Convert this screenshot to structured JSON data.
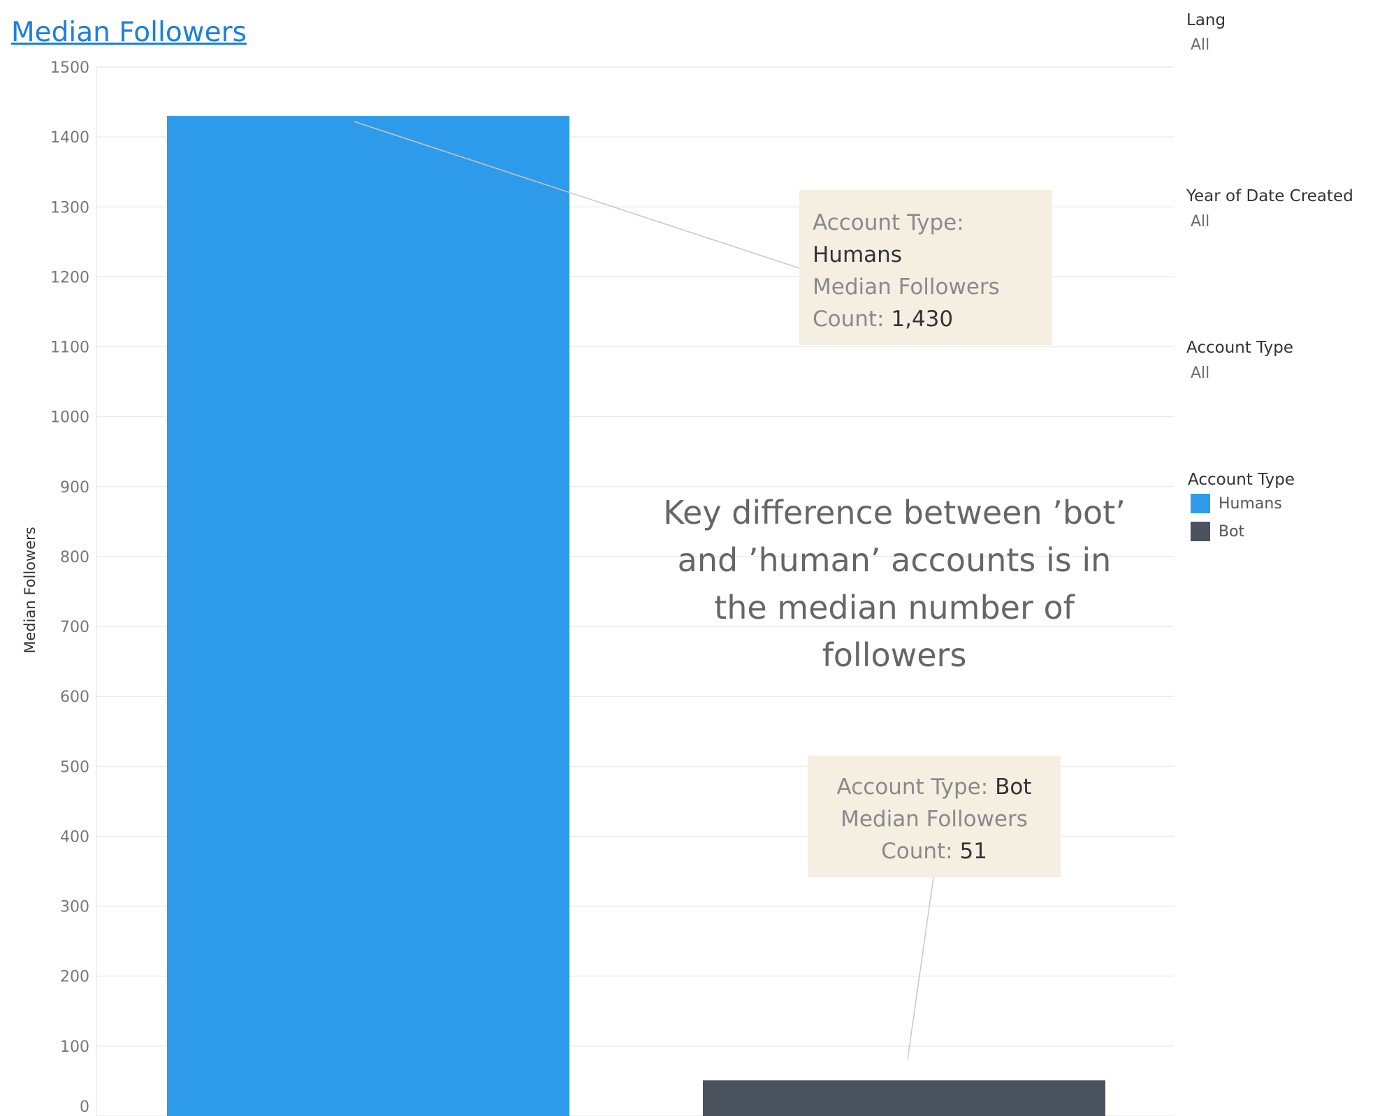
{
  "title": "Median Followers",
  "filters": [
    {
      "label": "Lang",
      "value": "All"
    },
    {
      "label": "Year of Date Created",
      "value": "All"
    },
    {
      "label": "Account Type",
      "value": "All"
    }
  ],
  "legend": {
    "title": "Account Type",
    "items": [
      {
        "label": "Humans",
        "color": "#2e9bea"
      },
      {
        "label": "Bot",
        "color": "#4a525d"
      }
    ]
  },
  "annotation": "Key difference between ’bot’ and ’human’ accounts is in the median number of followers",
  "callouts": {
    "humans": {
      "type_label": "Account Type:",
      "type_value": "Humans",
      "measure_label": "Median Followers",
      "count_label": "Count:",
      "count_value": "1,430"
    },
    "bot": {
      "type_label": "Account Type:",
      "type_value": "Bot",
      "measure_label": "Median Followers",
      "count_label": "Count:",
      "count_value": "51"
    }
  },
  "chart_data": {
    "type": "bar",
    "categories": [
      "Humans",
      "Bot"
    ],
    "values": [
      1430,
      51
    ],
    "colors": [
      "#2e9bea",
      "#4a525d"
    ],
    "title": "Median Followers",
    "xlabel": "",
    "ylabel": "Median Followers",
    "ylim": [
      0,
      1500
    ],
    "yticks": [
      0,
      100,
      200,
      300,
      400,
      500,
      600,
      700,
      800,
      900,
      1000,
      1100,
      1200,
      1300,
      1400,
      1500
    ],
    "grid": true,
    "legend_position": "right"
  }
}
